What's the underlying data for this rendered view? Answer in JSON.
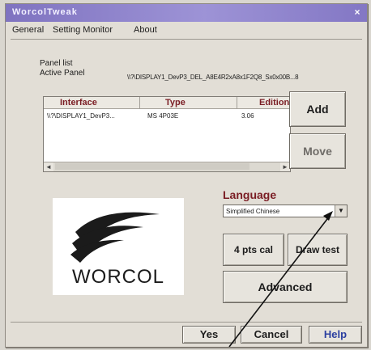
{
  "window": {
    "title": "WorcolTweak",
    "close_glyph": "×"
  },
  "tabs": [
    {
      "label": "General"
    },
    {
      "label": "Setting Monitor"
    },
    {
      "label": "About"
    }
  ],
  "panel": {
    "group_label": "Panel list",
    "active_label": "Active Panel",
    "active_value": "\\\\?\\DISPLAY1_DevP3_DEL_A8E4R2xA8x1F2Q8_Sx0x00B...8"
  },
  "list": {
    "columns": [
      "Interface",
      "Type",
      "Edition"
    ],
    "rows": [
      {
        "interface": "\\\\?\\DISPLAY1_DevP3...",
        "type": "MS 4P03E",
        "edition": "3.06"
      }
    ],
    "scroll_left": "◄",
    "scroll_right": "►"
  },
  "buttons": {
    "add": "Add",
    "move": "Move",
    "four_pts_cal": "4 pts cal",
    "draw_test": "Draw test",
    "advanced": "Advanced",
    "yes": "Yes",
    "cancel": "Cancel",
    "help": "Help"
  },
  "language": {
    "label": "Language",
    "selected": "Simplified Chinese",
    "dropdown_glyph": "▼"
  },
  "logo": {
    "text": "WORCOL"
  },
  "colors": {
    "title_bar": "#8c82c8",
    "accent_text": "#7a1d24",
    "window_bg": "#e2ded6"
  }
}
